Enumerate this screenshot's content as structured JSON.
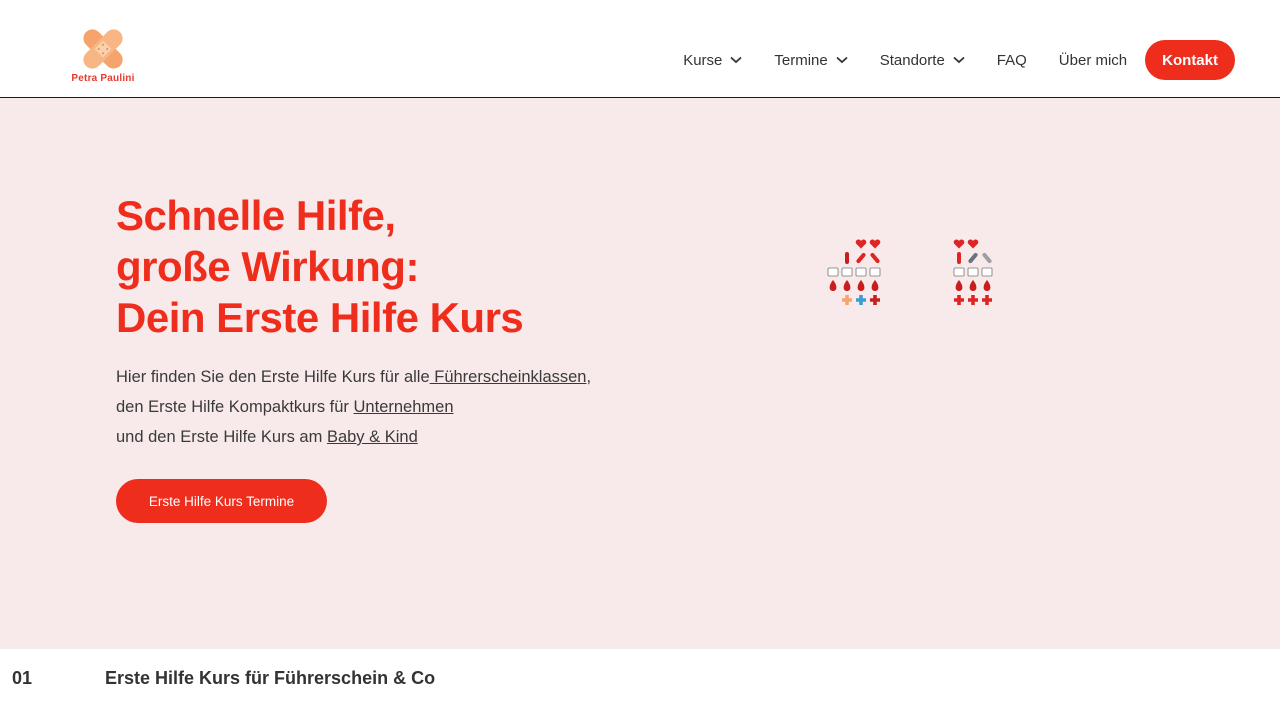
{
  "header": {
    "logo_text": "Petra Paulini",
    "nav": [
      {
        "label": "Kurse",
        "icon": "chevron-down-icon"
      },
      {
        "label": "Termine",
        "icon": "chevron-down-icon"
      },
      {
        "label": "Standorte",
        "icon": "chevron-down-icon"
      },
      {
        "label": "FAQ"
      },
      {
        "label": "Über mich"
      }
    ],
    "contact_label": "Kontakt"
  },
  "hero": {
    "headline": [
      "Schnelle Hilfe,",
      "große Wirkung:",
      "Dein Erste Hilfe Kurs"
    ],
    "intro": {
      "line1_prefix": "Hier finden Sie den Erste Hilfe Kurs für alle",
      "line1_link": " Führerscheinklassen",
      "line1_suffix": ",",
      "line2_prefix": "den Erste Hilfe Kompaktkurs für ",
      "line2_link": "Unternehmen ",
      "line3_prefix": "und den Erste Hilfe Kurs am ",
      "line3_link": "Baby & Kind"
    },
    "cta_label": "Erste Hilfe Kurs Termine",
    "image_icon": "heart-medical-icons-collage"
  },
  "section": {
    "number": "01",
    "title": "Erste Hilfe Kurs für Führerschein & Co"
  },
  "colors": {
    "accent": "#ef2d1d",
    "hero_bg": "#f8eaea",
    "logo_orange": "#f4a46c"
  }
}
